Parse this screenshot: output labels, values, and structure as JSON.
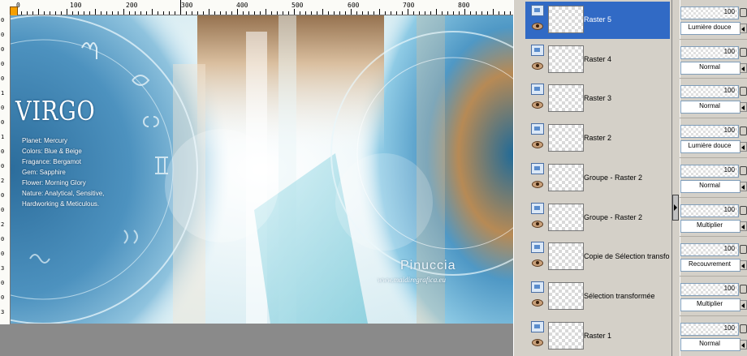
{
  "ruler": {
    "top_labels": [
      "0",
      "100",
      "200",
      "300",
      "400",
      "500",
      "600",
      "700",
      "800"
    ],
    "left_labels": [
      "0",
      "0",
      "0",
      "0",
      "0",
      "1",
      "0",
      "0",
      "1",
      "0",
      "0",
      "2",
      "0",
      "0",
      "2",
      "0",
      "0",
      "3",
      "0",
      "0",
      "3"
    ]
  },
  "canvas": {
    "title": "VIRGO",
    "info": [
      "Planet: Mercury",
      "Colors: Blue & Beige",
      "Fragance: Bergamot",
      "Gem: Sapphire",
      "Flower: Morning Glory",
      "Nature: Analytical, Sensitive,",
      "Hardworking & Meticulous."
    ],
    "signature": "Pinuccia",
    "watermark": "www.maidiregrafica.eu"
  },
  "layers": [
    {
      "name": "Raster 5",
      "opacity": "100",
      "blend": "Lumière douce",
      "selected": true
    },
    {
      "name": "Raster 4",
      "opacity": "100",
      "blend": "Normal",
      "selected": false
    },
    {
      "name": "Raster 3",
      "opacity": "100",
      "blend": "Normal",
      "selected": false
    },
    {
      "name": "Raster 2",
      "opacity": "100",
      "blend": "Lumière douce",
      "selected": false
    },
    {
      "name": "Groupe - Raster 2",
      "opacity": "100",
      "blend": "Normal",
      "selected": false
    },
    {
      "name": "Groupe - Raster 2",
      "opacity": "100",
      "blend": "Multiplier",
      "selected": false
    },
    {
      "name": "Copie de Sélection transformée",
      "opacity": "100",
      "blend": "Recouvrement",
      "selected": false
    },
    {
      "name": "Sélection transformée",
      "opacity": "100",
      "blend": "Multiplier",
      "selected": false
    },
    {
      "name": "Raster 1",
      "opacity": "100",
      "blend": "Normal",
      "selected": false
    }
  ],
  "colors": {
    "selection": "#316ac5",
    "panel": "#d4d0c8",
    "ruler_marker": "#f6a000"
  }
}
